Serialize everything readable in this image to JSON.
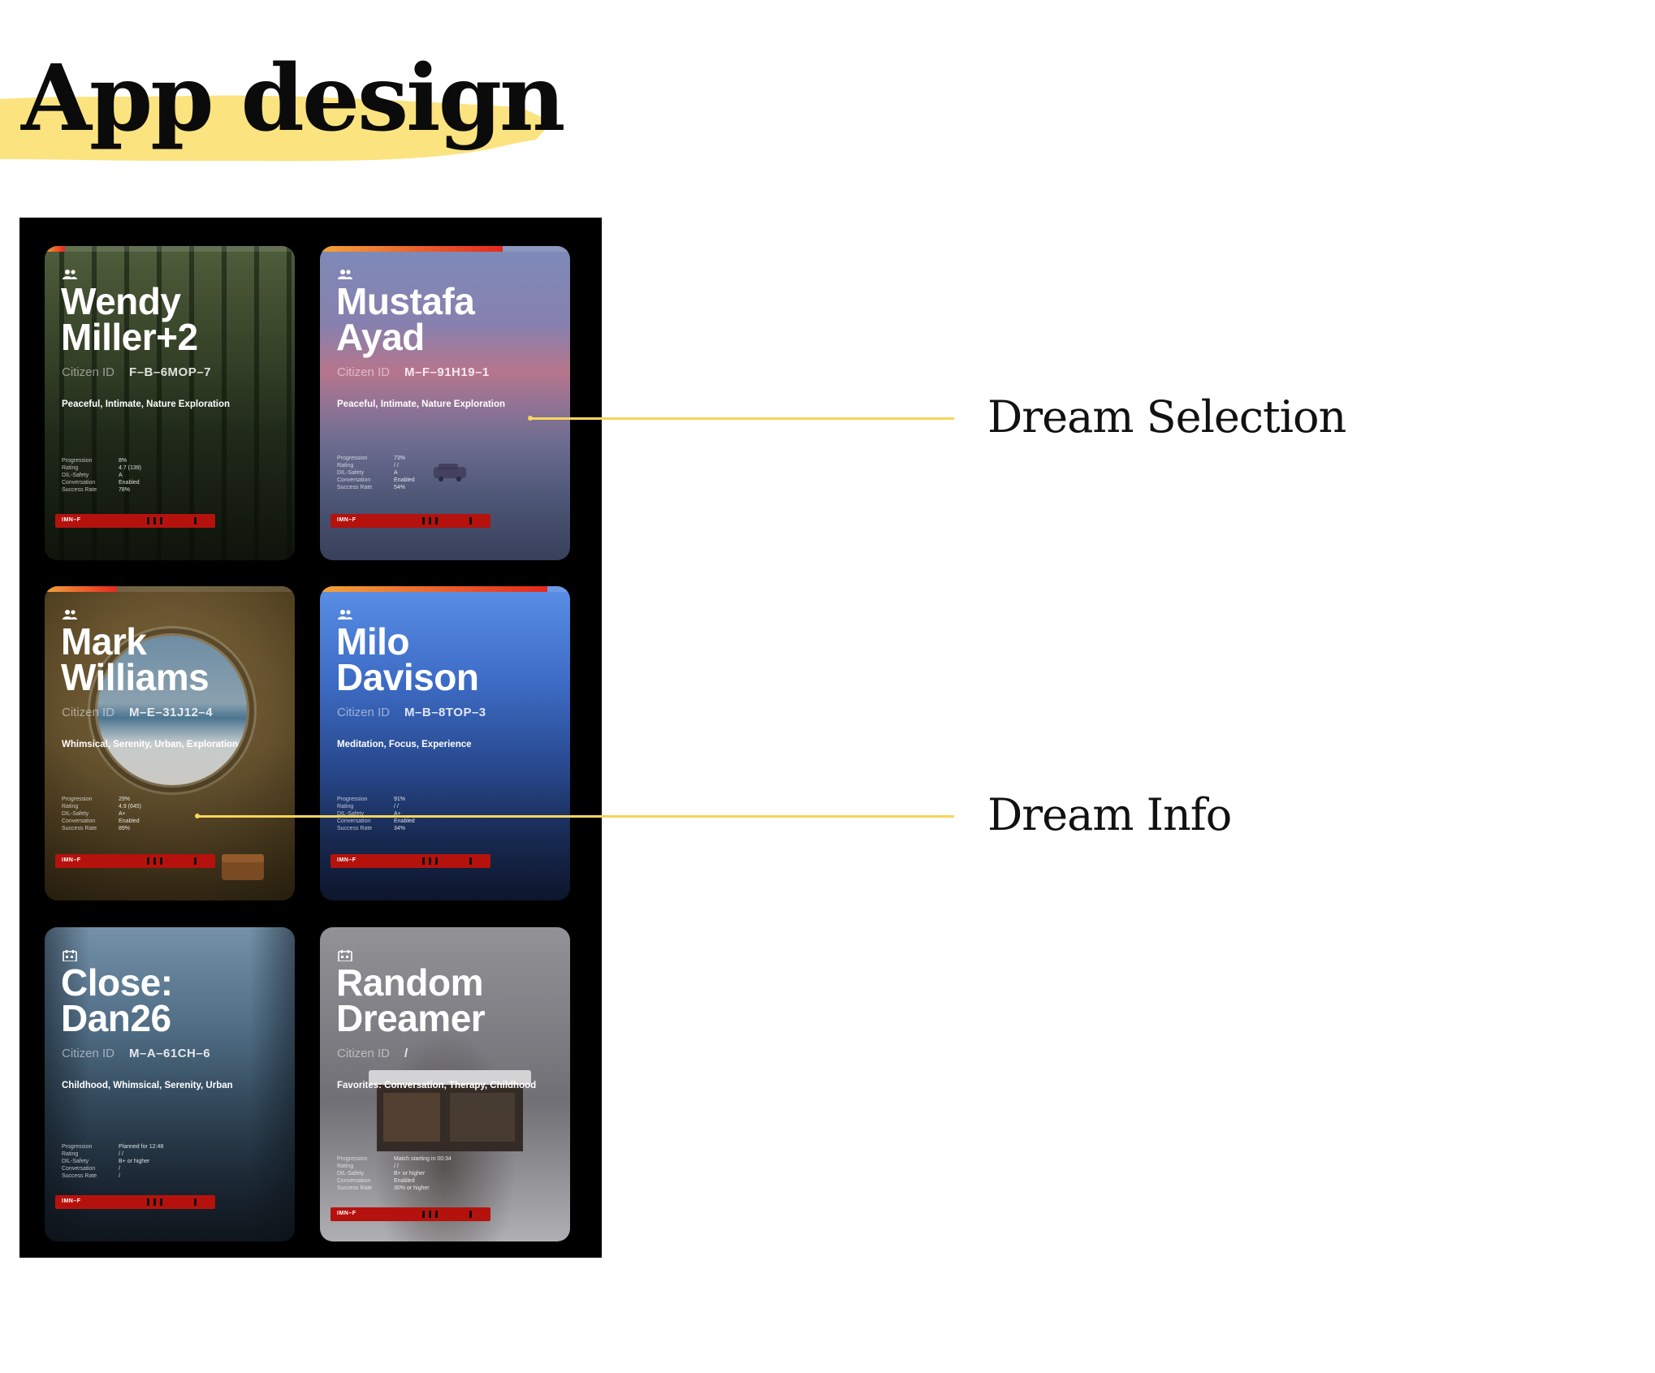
{
  "page": {
    "title": "App design"
  },
  "annotations": [
    {
      "text": "Dream Selection"
    },
    {
      "text": "Dream Info"
    }
  ],
  "colors": {
    "highlight": "#fbe37f",
    "connector": "#f7d65b",
    "phone_bg": "#000000",
    "bar_red": "#b5120e",
    "progress_start": "#f2a33a",
    "progress_end": "#e5281f"
  },
  "stat_labels": [
    "Progression",
    "Rating",
    "DIL-Safety",
    "Conversation",
    "Success Rate"
  ],
  "cid_label": "Citizen ID",
  "cards": [
    {
      "name_line1": "Wendy",
      "name_line2": "Miller+2",
      "citizen_id": "F–B–6MOP–7",
      "tags": "Peaceful, Intimate, Nature Exploration",
      "stats": [
        "8%",
        "4.7 (139)",
        "A",
        "Enabled",
        "78%"
      ],
      "bar_code": "IMN–F",
      "progress": 0.08,
      "icon": "group-icon",
      "theme": "forest"
    },
    {
      "name_line1": "Mustafa",
      "name_line2": "Ayad",
      "citizen_id": "M–F–91H19–1",
      "tags": "Peaceful, Intimate, Nature Exploration",
      "stats": [
        "73%",
        "/ /",
        "A",
        "Enabled",
        "54%"
      ],
      "bar_code": "IMN–F",
      "progress": 0.73,
      "icon": "group-icon",
      "theme": "sunset"
    },
    {
      "name_line1": "Mark",
      "name_line2": "Williams",
      "citizen_id": "M–E–31J12–4",
      "tags": "Whimsical, Serenity, Urban, Exploration",
      "stats": [
        "29%",
        "4.9 (645)",
        "A+",
        "Enabled",
        "89%"
      ],
      "bar_code": "IMN–F",
      "progress": 0.29,
      "icon": "group-icon",
      "theme": "porthole"
    },
    {
      "name_line1": "Milo",
      "name_line2": "Davison",
      "citizen_id": "M–B–8TOP–3",
      "tags": "Meditation, Focus, Experience",
      "stats": [
        "91%",
        "/ /",
        "A+",
        "Enabled",
        "34%"
      ],
      "bar_code": "IMN–F",
      "progress": 0.91,
      "icon": "group-icon",
      "theme": "blue"
    },
    {
      "name_line1": "Close:",
      "name_line2": "Dan26",
      "citizen_id": "M–A–61CH–6",
      "tags": "Childhood, Whimsical, Serenity, Urban",
      "stats": [
        "Planned for 12:48",
        "/ /",
        "B+ or higher",
        "/",
        "/"
      ],
      "bar_code": "IMN–F",
      "progress": 0,
      "icon": "calendar-icon",
      "theme": "alley"
    },
    {
      "name_line1": "Random",
      "name_line2": "Dreamer",
      "citizen_id": "/",
      "tags": "Favorites: Conversation, Therapy, Childhood",
      "stats": [
        "Match starting in 00:34",
        "/ /",
        "B+ or higher",
        "Enabled",
        "30% or higher"
      ],
      "bar_code": "IMN–F",
      "progress": 0,
      "icon": "calendar-icon",
      "theme": "snow"
    }
  ]
}
